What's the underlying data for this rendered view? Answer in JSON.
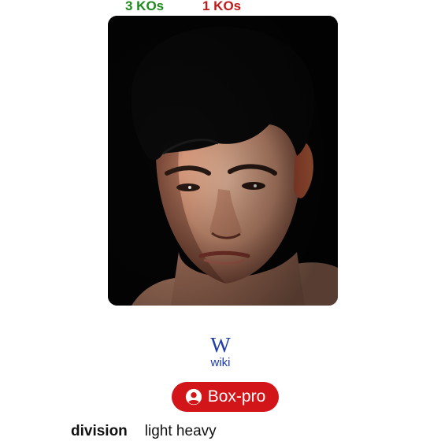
{
  "stats": {
    "kos_left": "3 KOs",
    "kos_right": "1 KOs",
    "colors": {
      "kos_left": "#1c8a1c",
      "kos_right": "#c11a1a"
    }
  },
  "photo": {
    "icon": "boxer-portrait"
  },
  "wiki": {
    "glyph": "W",
    "label": "wiki",
    "color": "#1a3cad"
  },
  "boxpro": {
    "icon": "user-circle-icon",
    "label": "Box-pro",
    "color": "#d21519"
  },
  "details": {
    "division_key": "division",
    "division_value": "light heavy"
  }
}
